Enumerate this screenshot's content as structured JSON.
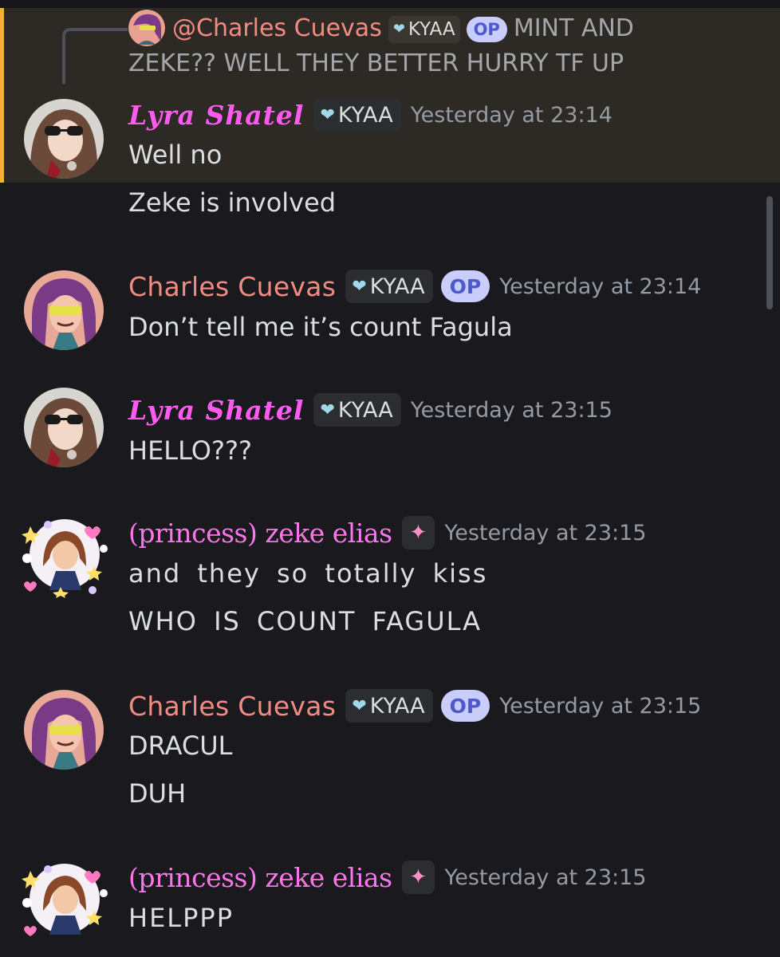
{
  "reply": {
    "author": "@Charles Cuevas",
    "tag": "KYAA",
    "op": "OP",
    "text": "MINT AND ZEKE?? WELL THEY BETTER HURRY TF UP"
  },
  "messages": [
    {
      "author": "Lyra Shatel",
      "tag": "KYAA",
      "time": "Yesterday at 23:14",
      "lines": [
        "Well no",
        "Zeke is involved"
      ]
    },
    {
      "author": "Charles Cuevas",
      "tag": "KYAA",
      "op": "OP",
      "time": "Yesterday at 23:14",
      "lines": [
        "Don’t tell me it’s count Fagula"
      ]
    },
    {
      "author": "Lyra Shatel",
      "tag": "KYAA",
      "time": "Yesterday at 23:15",
      "lines": [
        "HELLO???"
      ]
    },
    {
      "author": "(princess) zeke elias",
      "time": "Yesterday at 23:15",
      "lines": [
        "and they so totally kiss",
        "WHO IS COUNT FAGULA"
      ]
    },
    {
      "author": "Charles Cuevas",
      "tag": "KYAA",
      "op": "OP",
      "time": "Yesterday at 23:15",
      "lines": [
        "DRACUL",
        "DUH"
      ]
    },
    {
      "author": "(princess) zeke elias",
      "time": "Yesterday at 23:15",
      "lines": [
        "HELPPP"
      ]
    }
  ],
  "icons": {
    "tag": "heart-icon",
    "zeke_tag": "bow-icon"
  },
  "colors": {
    "lyra": "#ff5bf0",
    "charles": "#f28b82",
    "zeke": "#ff75ea",
    "highlight_border": "#f0b232",
    "op_badge": "#c9cdfb"
  }
}
